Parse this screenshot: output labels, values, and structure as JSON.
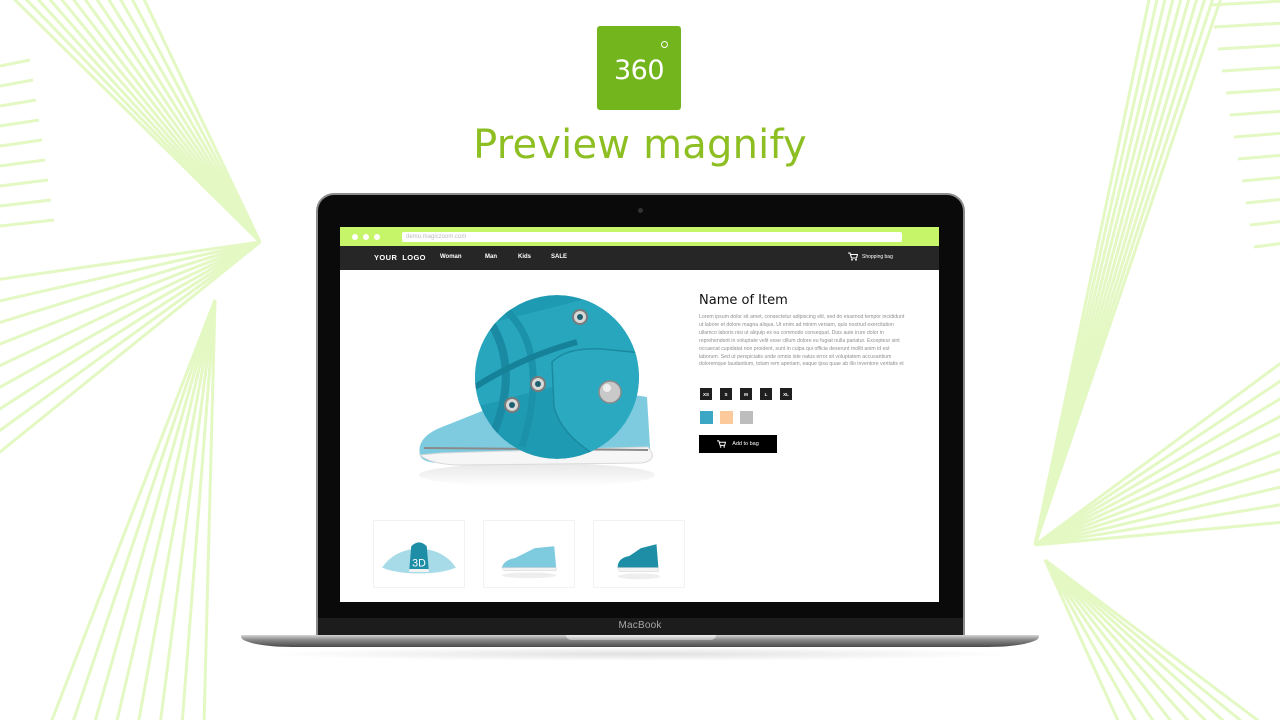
{
  "header": {
    "logo_text": "360",
    "headline": "Preview magnify"
  },
  "colors": {
    "brand_green": "#72b51c",
    "headline_green": "#8dbf22",
    "browser_bar": "#c6f56a",
    "nav_bg": "#262626",
    "decor_lines": "#e3f8c3"
  },
  "device": {
    "label": "MacBook"
  },
  "browser": {
    "url": "demo.magiczoom.com",
    "window_dots": 3
  },
  "site": {
    "logo": "YOUR  LOGO",
    "nav": [
      {
        "label": "Woman"
      },
      {
        "label": "Man"
      },
      {
        "label": "Kids"
      },
      {
        "label": "SALE"
      }
    ],
    "cart": {
      "icon": "shopping-cart-icon",
      "label": "Shopping bag"
    }
  },
  "product": {
    "name": "Name of Item",
    "description": "Lorem ipsum dolor sit amet, consectetur adipiscing elit, sed do eiusmod tempor incididunt ut labore et dolore magna aliqua. Ut enim ad minim veniam, quis nostrud exercitation ullamco laboris nisi ut aliquip ex ea commodo consequat. Duis aute irure dolor in reprehenderit in voluptate velit esse cillum dolore eu fugiat nulla pariatur. Excepteur sint occaecat cupidatat non proident, sunt in culpa qui officia deserunt mollit anim id est laborum. Sed ut perspiciatis unde omnis iste natus error sit voluptatem accusantium doloremque laudantium, totam rem aperiam, eaque ipsa quae ab illo inventore veritatis et",
    "sizes": [
      "XS",
      "S",
      "M",
      "L",
      "XL"
    ],
    "colors": [
      {
        "name": "teal",
        "hex": "#3ba7c4"
      },
      {
        "name": "peach",
        "hex": "#fcc99b"
      },
      {
        "name": "gray",
        "hex": "#bdbdbd"
      }
    ],
    "add_to_bag_label": "Add to bag",
    "magnifier": "zoom-lens-active",
    "thumbnails": [
      {
        "label": "3D",
        "kind": "360-spin"
      },
      {
        "label": "",
        "kind": "side-view"
      },
      {
        "label": "",
        "kind": "back-view"
      }
    ]
  }
}
